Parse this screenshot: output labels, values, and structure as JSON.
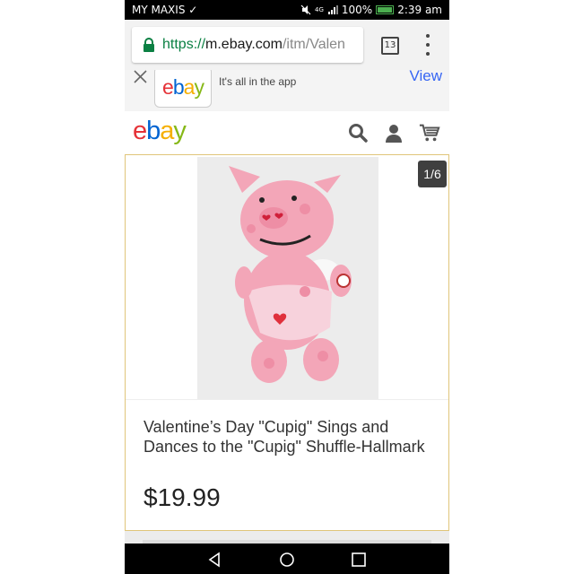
{
  "status_bar": {
    "carrier": "MY MAXIS",
    "network": "4G",
    "battery": "100%",
    "time": "2:39 am",
    "icons": [
      "mute-icon",
      "signal-icon",
      "battery-icon"
    ]
  },
  "browser": {
    "url_scheme": "https://",
    "url_host": "m.ebay.com",
    "url_path": "/itm/Valen",
    "tab_count": "13"
  },
  "app_banner": {
    "logo_text": "ebay",
    "tagline": "It's all in the app",
    "view_label": "View"
  },
  "header": {
    "logo_parts": [
      "e",
      "b",
      "a",
      "y"
    ],
    "icons": [
      "search-icon",
      "user-icon",
      "cart-icon"
    ]
  },
  "product": {
    "image_counter": "1/6",
    "title": "Valentine’s Day \"Cupig\" Sings and Dances to the \"Cupig\" Shuffle-Hallmark",
    "price": "$19.99"
  },
  "nav_bar": {
    "icons": [
      "back-icon",
      "home-icon",
      "recents-icon"
    ]
  },
  "colors": {
    "ebay_red": "#e53238",
    "ebay_blue": "#0064d2",
    "ebay_yellow": "#f5af02",
    "ebay_green": "#86b817",
    "link_blue": "#3665f3"
  }
}
